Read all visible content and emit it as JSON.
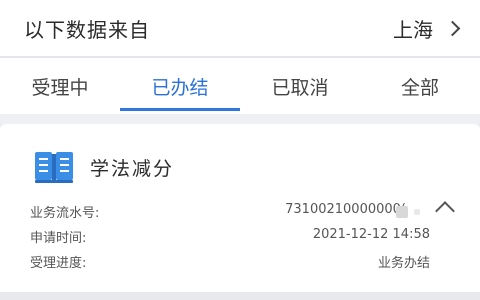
{
  "header": {
    "title": "以下数据来自",
    "region": "上海"
  },
  "tabs": [
    {
      "label": "受理中"
    },
    {
      "label": "已办结"
    },
    {
      "label": "已取消"
    },
    {
      "label": "全部"
    }
  ],
  "active_tab": "已办结",
  "card": {
    "title": "学法减分",
    "rows": [
      {
        "label": "业务流水号:",
        "value": "73100210000000("
      },
      {
        "label": "申请时间:",
        "value": "2021-12-12 14:58"
      },
      {
        "label": "受理进度:",
        "value": "业务办结"
      }
    ]
  },
  "colors": {
    "accent": "#2f79dc",
    "icon": "#3a8ee6",
    "background": "#edeef1"
  },
  "icons": {
    "region_chevron": "chevron-right-icon",
    "card_icon": "book-icon",
    "collapse": "chevron-up-icon"
  }
}
